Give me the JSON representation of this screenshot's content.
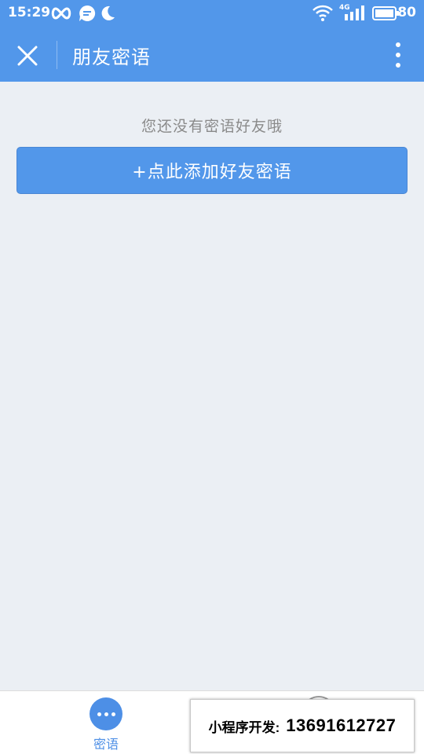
{
  "status_bar": {
    "time": "15:29",
    "network": "4G",
    "battery": "80",
    "icons": [
      "infinity-icon",
      "chat-icon",
      "moon-icon",
      "wifi-icon",
      "signal-icon",
      "battery-icon"
    ]
  },
  "navbar": {
    "title": "朋友密语",
    "close_icon": "close-icon",
    "more_icon": "more-vertical-icon"
  },
  "main": {
    "empty_message": "您还没有密语好友哦",
    "add_button_label": "+点此添加好友密语"
  },
  "tabbar": {
    "tabs": [
      {
        "label": "密语",
        "icon": "chat-bubble-icon",
        "active": true
      },
      {
        "label": "",
        "icon": "circle-icon",
        "active": false
      }
    ]
  },
  "watermark": {
    "label": "小程序开发:",
    "phone": "13691612727"
  },
  "colors": {
    "primary": "#5297ea",
    "background": "#ebeff4",
    "muted_text": "#8a8a8a"
  }
}
